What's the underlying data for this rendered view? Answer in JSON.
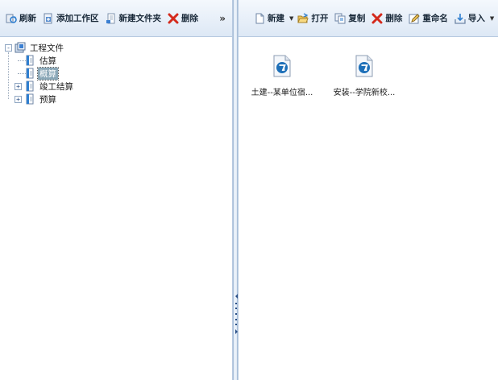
{
  "left_toolbar": {
    "refresh_label": "刷新",
    "add_workspace_label": "添加工作区",
    "new_folder_label": "新建文件夹",
    "delete_label": "删除",
    "overflow_label": "»"
  },
  "right_toolbar": {
    "new_label": "新建",
    "open_label": "打开",
    "copy_label": "复制",
    "delete_label": "删除",
    "rename_label": "重命名",
    "import_label": "导入"
  },
  "tree": {
    "root_label": "工程文件",
    "root_toggle": "-",
    "children": [
      {
        "label": "估算"
      },
      {
        "label": "概算"
      },
      {
        "label": "竣工结算",
        "toggle": "+"
      },
      {
        "label": "预算",
        "toggle": "+"
      }
    ]
  },
  "files": [
    {
      "name": "土建--某单位宿..."
    },
    {
      "name": "安装--学院新校..."
    }
  ],
  "colors": {
    "toolbar_bg": "#dde8f5",
    "selected_bg": "#8aa7b7",
    "delete_red": "#d42a1c",
    "file_icon_blue": "#1d6fb8"
  }
}
